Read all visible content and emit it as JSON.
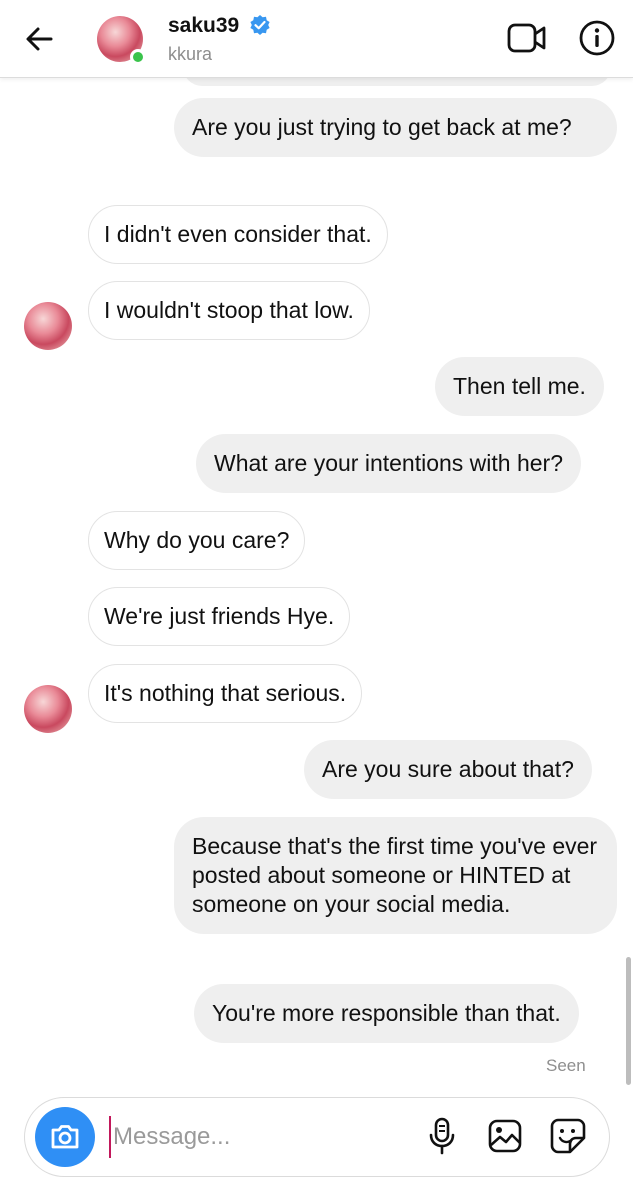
{
  "header": {
    "username": "saku39",
    "subtitle": "kkura",
    "icons": [
      "back-arrow-icon",
      "verified-badge-icon",
      "video-call-icon",
      "info-icon"
    ],
    "online_color": "#3ac34b",
    "verified_color": "#3897f0"
  },
  "messages": [
    {
      "side": "out",
      "text": "Are you just trying to get back at me?"
    },
    {
      "side": "in",
      "text": "I didn't even consider that."
    },
    {
      "side": "in",
      "text": "I wouldn't stoop that low.",
      "avatar": true
    },
    {
      "side": "out",
      "text": "Then tell me."
    },
    {
      "side": "out",
      "text": "What are your intentions with her?"
    },
    {
      "side": "in",
      "text": "Why do you care?"
    },
    {
      "side": "in",
      "text": "We're just friends Hye."
    },
    {
      "side": "in",
      "text": "It's nothing that serious.",
      "avatar": true
    },
    {
      "side": "out",
      "text": "Are you sure about that?"
    },
    {
      "side": "out",
      "text": "Because that's the first time you've ever posted about someone or HINTED at someone on your social media."
    },
    {
      "side": "out",
      "text": "You're more responsible than that."
    }
  ],
  "status": {
    "seen": "Seen"
  },
  "composer": {
    "placeholder": "Message...",
    "value": "",
    "icons": [
      "camera-icon",
      "microphone-icon",
      "gallery-icon",
      "sticker-icon"
    ],
    "camera_color": "#2f8ff5"
  }
}
